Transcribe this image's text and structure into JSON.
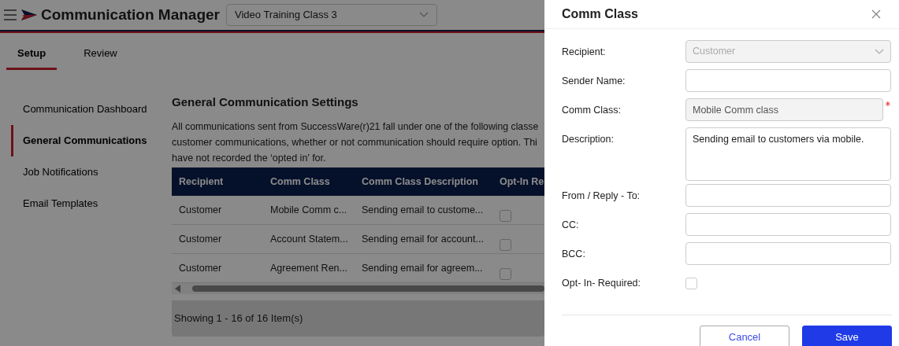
{
  "app": {
    "title": "Communication Manager",
    "class_select": {
      "value": "Video Training Class 3"
    }
  },
  "tabs": [
    {
      "label": "Setup",
      "selected": true
    },
    {
      "label": "Review",
      "selected": false
    }
  ],
  "sidebar": {
    "items": [
      {
        "label": "Communication Dashboard",
        "selected": false
      },
      {
        "label": "General Communications",
        "selected": true
      },
      {
        "label": "Job Notifications",
        "selected": false
      },
      {
        "label": "Email Templates",
        "selected": false
      }
    ]
  },
  "content": {
    "heading": "General Communication Settings",
    "intro_lines": [
      "All communications sent from SuccessWare(r)21 fall under one of the following classe",
      "customer communications, whether or not communication should require option. Thi",
      "have not recorded the ‘opted in’ for."
    ],
    "table": {
      "columns": [
        "Recipient",
        "Comm Class",
        "Comm Class Description",
        "Opt-In Re"
      ],
      "rows": [
        {
          "cells": [
            "Customer",
            "Mobile Comm c...",
            "Sending email to custome..."
          ],
          "opt_in": false
        },
        {
          "cells": [
            "Customer",
            "Account Statem...",
            "Sending email for account..."
          ],
          "opt_in": false
        },
        {
          "cells": [
            "Customer",
            "Agreement Ren...",
            "Sending email for agreem..."
          ],
          "opt_in": false
        }
      ]
    },
    "footer": "Showing 1 - 16 of 16 Item(s)"
  },
  "drawer": {
    "title": "Comm Class",
    "fields": [
      {
        "kind": "select",
        "label": "Recipient:",
        "value": "Customer",
        "disabled": true
      },
      {
        "kind": "text",
        "label": "Sender Name:",
        "disabled": false
      },
      {
        "kind": "text",
        "label": "Comm Class:",
        "value": "Mobile Comm class",
        "disabled": true,
        "required": true
      },
      {
        "kind": "textarea",
        "label": "Description:",
        "value": "Sending email to customers via mobile.",
        "disabled": false
      },
      {
        "kind": "text",
        "label": "From / Reply - To:",
        "disabled": false
      },
      {
        "kind": "text",
        "label": "CC:",
        "disabled": false
      },
      {
        "kind": "text",
        "label": "BCC:",
        "disabled": false
      },
      {
        "kind": "checkbox",
        "label": "Opt- In- Required:",
        "checked": false
      }
    ],
    "buttons": [
      {
        "kind": "secondary",
        "label": "Cancel"
      },
      {
        "kind": "primary",
        "label": "Save"
      }
    ]
  }
}
